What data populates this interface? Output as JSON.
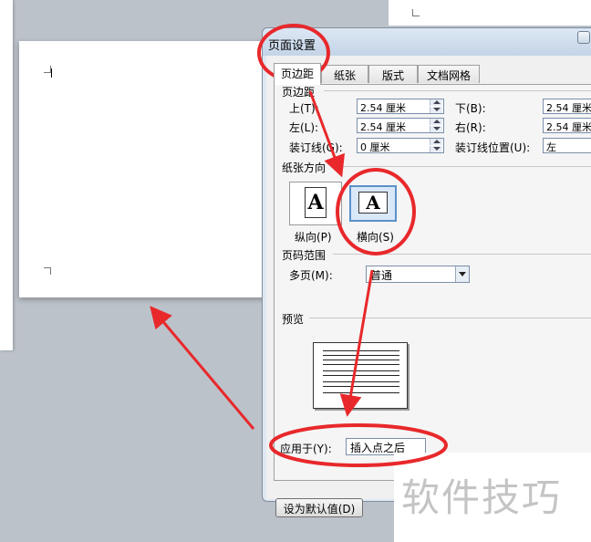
{
  "dialog": {
    "title": "页面设置",
    "tabs": [
      {
        "label": "页边距",
        "active": true
      },
      {
        "label": "纸张",
        "active": false
      },
      {
        "label": "版式",
        "active": false
      },
      {
        "label": "文档网格",
        "active": false
      }
    ],
    "margins": {
      "section_title": "页边距",
      "top_label": "上(T):",
      "top_value": "2.54 厘米",
      "bottom_label": "下(B):",
      "bottom_value": "2.54 厘米",
      "left_label": "左(L):",
      "left_value": "2.54 厘米",
      "right_label": "右(R):",
      "right_value": "2.54 厘米",
      "gutter_label": "装订线(G):",
      "gutter_value": "0 厘米",
      "gutter_pos_label": "装订线位置(U):",
      "gutter_pos_value": "左"
    },
    "orientation": {
      "section_title": "纸张方向",
      "portrait_label": "纵向(P)",
      "landscape_label": "横向(S)",
      "icon_letter": "A",
      "selected": "landscape"
    },
    "pages": {
      "section_title": "页码范围",
      "multiple_label": "多页(M):",
      "multiple_value": "普通"
    },
    "preview": {
      "section_title": "预览"
    },
    "apply": {
      "label": "应用于(Y):",
      "value": "插入点之后"
    },
    "default_button": "设为默认值(D)"
  },
  "watermark": "软件技巧",
  "colors": {
    "annotation_red": "#e8282b",
    "dialog_bg": "#f0f0f0",
    "workspace_bg": "#bcc2ca"
  }
}
